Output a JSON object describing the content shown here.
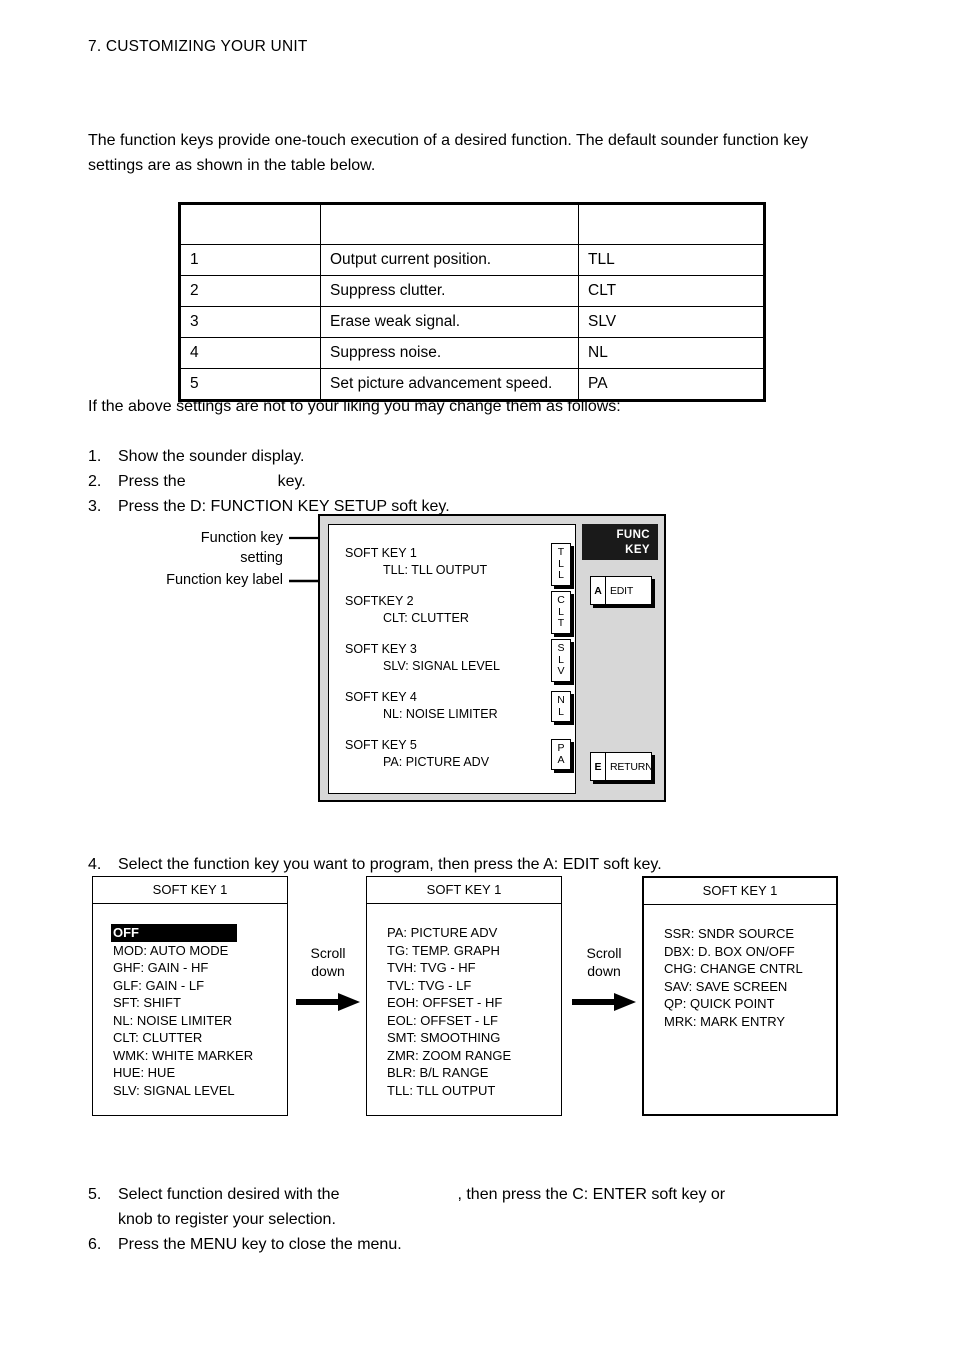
{
  "page": {
    "running_header": "7. CUSTOMIZING YOUR UNIT",
    "intro_paragraph": "The function keys provide one-touch execution of a desired function. The default sounder function key settings are as shown in the table below.",
    "lead_in": "If the above settings are not to your liking you may change them as follows:"
  },
  "settings_table": {
    "headers": [
      "",
      "",
      ""
    ],
    "rows": [
      {
        "no": "1",
        "function": "Output current position.",
        "label": "TLL"
      },
      {
        "no": "2",
        "function": "Suppress clutter.",
        "label": "CLT"
      },
      {
        "no": "3",
        "function": "Erase weak signal.",
        "label": "SLV"
      },
      {
        "no": "4",
        "function": "Suppress noise.",
        "label": "NL"
      },
      {
        "no": "5",
        "function": "Set picture advancement speed.",
        "label": "PA"
      }
    ]
  },
  "steps": {
    "s1": {
      "num": "1.",
      "text": "Show the sounder display."
    },
    "s2": {
      "num": "2.",
      "text_before": "Press the",
      "text_after": "key."
    },
    "s3": {
      "num": "3.",
      "text": "Press the D: FUNCTION KEY SETUP soft key."
    },
    "s4": {
      "num": "4.",
      "text": "Select the function key you want to program, then press the A: EDIT soft key."
    },
    "s5": {
      "num": "5.",
      "text_before": "Select function desired with the",
      "text_after": ", then press the C: ENTER soft key or",
      "text_line2": "knob to register your selection."
    },
    "s6": {
      "num": "6.",
      "text": "Press the MENU key to close the menu."
    }
  },
  "diagram": {
    "callout_setting": "Function key setting",
    "callout_label": "Function key label",
    "panel_title_line1": "FUNC",
    "panel_title_line2": "KEY",
    "softkeys": [
      {
        "title": "SOFT KEY 1",
        "value": "TLL: TLL OUTPUT",
        "keycap": [
          "T",
          "L",
          "L"
        ]
      },
      {
        "title": "SOFTKEY 2",
        "value": "CLT: CLUTTER",
        "keycap": [
          "C",
          "L",
          "T"
        ]
      },
      {
        "title": "SOFT KEY 3",
        "value": "SLV: SIGNAL LEVEL",
        "keycap": [
          "S",
          "L",
          "V"
        ]
      },
      {
        "title": "SOFT KEY 4",
        "value": "NL: NOISE LIMITER",
        "keycap": [
          "N",
          "L"
        ]
      },
      {
        "title": "SOFT KEY 5",
        "value": "PA: PICTURE ADV",
        "keycap": [
          "P",
          "A"
        ]
      }
    ],
    "soft_buttons": [
      {
        "letter": "A",
        "label": "EDIT"
      },
      {
        "letter": "E",
        "label": "RETURN"
      }
    ]
  },
  "option_boxes": [
    {
      "title": "SOFT KEY 1",
      "items": [
        {
          "text": "OFF",
          "selected": true
        },
        {
          "text": "MOD: AUTO MODE",
          "selected": false
        },
        {
          "text": "GHF: GAIN - HF",
          "selected": false
        },
        {
          "text": "GLF: GAIN - LF",
          "selected": false
        },
        {
          "text": "SFT: SHIFT",
          "selected": false
        },
        {
          "text": "NL: NOISE LIMITER",
          "selected": false
        },
        {
          "text": "CLT: CLUTTER",
          "selected": false
        },
        {
          "text": "WMK: WHITE MARKER",
          "selected": false
        },
        {
          "text": "HUE: HUE",
          "selected": false
        },
        {
          "text": "SLV: SIGNAL LEVEL",
          "selected": false
        }
      ]
    },
    {
      "title": "SOFT KEY 1",
      "items": [
        {
          "text": "PA: PICTURE ADV",
          "selected": false
        },
        {
          "text": "TG: TEMP. GRAPH",
          "selected": false
        },
        {
          "text": "TVH: TVG - HF",
          "selected": false
        },
        {
          "text": "TVL: TVG - LF",
          "selected": false
        },
        {
          "text": "EOH: OFFSET - HF",
          "selected": false
        },
        {
          "text": "EOL: OFFSET - LF",
          "selected": false
        },
        {
          "text": "SMT: SMOOTHING",
          "selected": false
        },
        {
          "text": "ZMR: ZOOM RANGE",
          "selected": false
        },
        {
          "text": "BLR: B/L RANGE",
          "selected": false
        },
        {
          "text": "TLL: TLL OUTPUT",
          "selected": false
        }
      ]
    },
    {
      "title": "SOFT KEY 1",
      "items": [
        {
          "text": "SSR: SNDR SOURCE",
          "selected": false
        },
        {
          "text": "DBX: D. BOX ON/OFF",
          "selected": false
        },
        {
          "text": "CHG: CHANGE CNTRL",
          "selected": false
        },
        {
          "text": "SAV: SAVE SCREEN",
          "selected": false
        },
        {
          "text": "QP: QUICK POINT",
          "selected": false
        },
        {
          "text": "MRK: MARK ENTRY",
          "selected": false
        }
      ]
    }
  ],
  "scroll_notes": [
    {
      "line1": "Scroll",
      "line2": "down"
    },
    {
      "line1": "Scroll",
      "line2": "down"
    }
  ],
  "colors": {
    "ink": "#000000",
    "paper": "#ffffff",
    "panel_gray": "#d7d7d7",
    "panel_title_bg": "#1a1a1a"
  }
}
